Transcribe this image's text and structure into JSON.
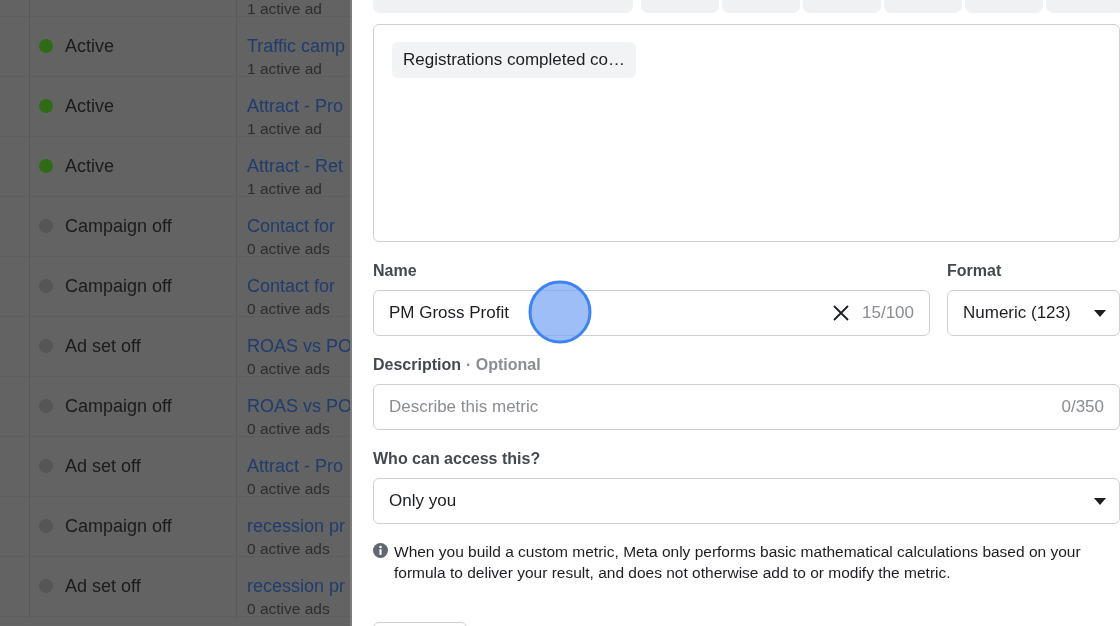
{
  "campaign_table": {
    "rows": [
      {
        "detail": "1 active ad"
      },
      {
        "status": "Active",
        "color": "#2f6b14",
        "campaign": "Traffic camp",
        "detail": "1 active ad"
      },
      {
        "status": "Active",
        "color": "#2f6b14",
        "campaign": "Attract - Pro",
        "detail": "1 active ad"
      },
      {
        "status": "Active",
        "color": "#2f6b14",
        "campaign": "Attract - Ret",
        "detail": "1 active ad"
      },
      {
        "status": "Campaign off",
        "color": "#565656",
        "campaign": "Contact for",
        "detail": "0 active ads"
      },
      {
        "status": "Campaign off",
        "color": "#565656",
        "campaign": "Contact for",
        "detail": "0 active ads"
      },
      {
        "status": "Ad set off",
        "color": "#565656",
        "campaign": "ROAS vs PO",
        "detail": "0 active ads"
      },
      {
        "status": "Campaign off",
        "color": "#565656",
        "campaign": "ROAS vs PO",
        "detail": "0 active ads"
      },
      {
        "status": "Ad set off",
        "color": "#565656",
        "campaign": "Attract - Pro",
        "detail": "0 active ads"
      },
      {
        "status": "Campaign off",
        "color": "#565656",
        "campaign": "recession pr",
        "detail": "0 active ads"
      },
      {
        "status": "Ad set off",
        "color": "#565656",
        "campaign": "recession pr",
        "detail": "0 active ads"
      }
    ]
  },
  "metric_panel": {
    "formula": {
      "tokens": [
        "Registrations completed co…"
      ]
    },
    "name": {
      "label": "Name",
      "value": "PM Gross Profit",
      "counter": "15/100"
    },
    "format": {
      "label": "Format",
      "value": "Numeric (123)"
    },
    "description": {
      "label": "Description",
      "optional": "· Optional",
      "placeholder": "Describe this metric",
      "counter": "0/350"
    },
    "access": {
      "label": "Who can access this?",
      "value": "Only you"
    },
    "notice": "When you build a custom metric, Meta only performs basic mathematical calculations based on your formula to deliver your result, and does not otherwise add to or modify the metric."
  }
}
